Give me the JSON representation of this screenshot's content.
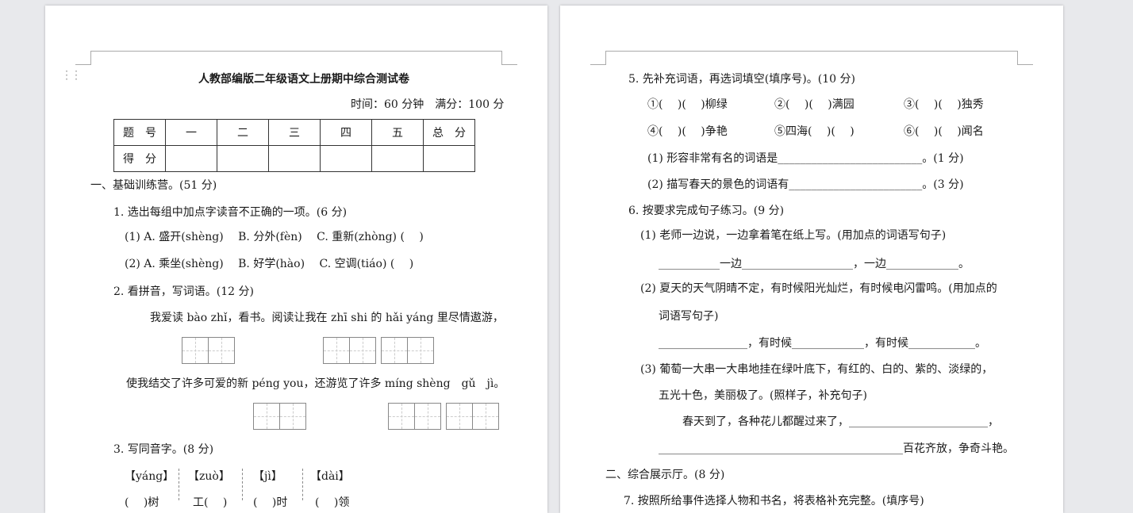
{
  "left_page": {
    "title": "人教部编版二年级语文上册期中综合测试卷",
    "time_info": "时间：60 分钟　满分：100 分",
    "score_table": {
      "header": [
        "题　号",
        "一",
        "二",
        "三",
        "四",
        "五",
        "总　分"
      ],
      "row2_label": "得　分"
    },
    "section1": "一、基础训练营。(51 分)",
    "q1": {
      "title": "1. 选出每组中加点字读音不正确的一项。(6 分)",
      "line1": "(1) A. 盛开(shèng)　 B. 分外(fèn)　 C. 重新(zhòng) (　 )",
      "line2": "(2) A. 乘坐(shèng)　 B. 好学(hào)　 C. 空调(tiáo) (　 )"
    },
    "q2": {
      "title": "2. 看拼音，写词语。(12 分)",
      "line1": "我爱读 bào zhǐ，看书。阅读让我在 zhī shi 的 hǎi yáng 里尽情遨游，",
      "line2": "使我结交了许多可爱的新 péng you，还游览了许多 míng shèng　gǔ　jì。"
    },
    "q3": {
      "title": "3. 写同音字。(8 分)",
      "headers": [
        "【yáng】",
        "【zuò】",
        "【jì】",
        "【dài】"
      ],
      "blanks": [
        "(　 )树",
        "工(　 )",
        "(　 )时",
        "(　 )领"
      ]
    }
  },
  "right_page": {
    "q5": {
      "title": "5. 先补充词语，再选词填空(填序号)。(10 分)",
      "row1": [
        "①(　 )(　 )柳绿",
        "②(　 )(　 )满园",
        "③(　 )(　 )独秀"
      ],
      "row2": [
        "④(　 )(　 )争艳",
        "⑤四海(　 )(　 )",
        "⑥(　 )(　 )闻名"
      ],
      "sub1": "(1) 形容非常有名的词语是__________________________。(1 分)",
      "sub2": "(2) 描写春天的景色的词语有________________________。(3 分)"
    },
    "q6": {
      "title": "6. 按要求完成句子练习。(9 分)",
      "s1": "(1) 老师一边说，一边拿着笔在纸上写。(用加点的词语写句子)",
      "s1_fill": "___________一边____________________，一边_____________。",
      "s2a": "(2) 夏天的天气阴晴不定，有时候阳光灿烂，有时候电闪雷鸣。(用加点的",
      "s2b": "词语写句子)",
      "s2_fill": "________________，有时候_____________，有时候____________。",
      "s3a": "(3) 葡萄一大串一大串地挂在绿叶底下，有红的、白的、紫的、淡绿的，",
      "s3b": "五光十色，美丽极了。(照样子，补充句子)",
      "s3_line1": "春天到了，各种花儿都醒过来了，_________________________，",
      "s3_line2": "____________________________________________百花齐放，争奇斗艳。"
    },
    "section2": "二、综合展示厅。(8 分)",
    "q7": "7. 按照所给事件选择人物和书名，将表格补充完整。(填序号)"
  }
}
